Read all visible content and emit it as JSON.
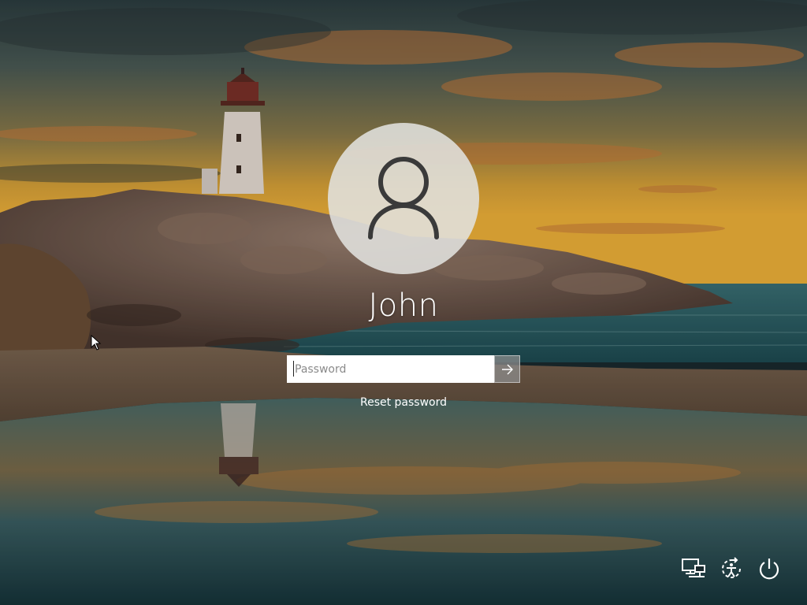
{
  "user": {
    "name": "John"
  },
  "login": {
    "password_placeholder": "Password",
    "reset_password_label": "Reset password"
  },
  "icons": {
    "avatar": "user-silhouette-icon",
    "submit": "arrow-right-icon",
    "network": "network-icon",
    "ease_of_access": "ease-of-access-icon",
    "power": "power-icon"
  },
  "colors": {
    "text": "#ffffff",
    "avatar_background": "#e1e1de",
    "input_background": "#ffffff",
    "submit_background": "#8c8c8c"
  }
}
